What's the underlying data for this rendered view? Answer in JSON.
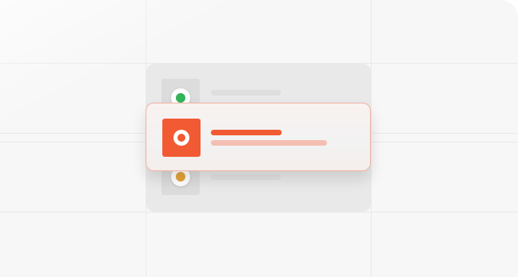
{
  "colors": {
    "background": "#f7f7f7",
    "grid_line": "#e9e9e9",
    "panel": "#e9e9e9",
    "rail": "#dcdcdc",
    "accent": "#f15a33",
    "accent_light": "#f4bfb2",
    "card_border": "#f1b3a5",
    "status_green": "#34b35a",
    "status_amber": "#e3a53a",
    "placeholder_bar": "#dedede"
  },
  "list": {
    "items": [
      {
        "icon": "green-status-dot-icon",
        "state": "inactive"
      },
      {
        "icon": "record-target-icon",
        "state": "selected"
      },
      {
        "icon": "amber-status-dot-icon",
        "state": "inactive"
      }
    ]
  }
}
